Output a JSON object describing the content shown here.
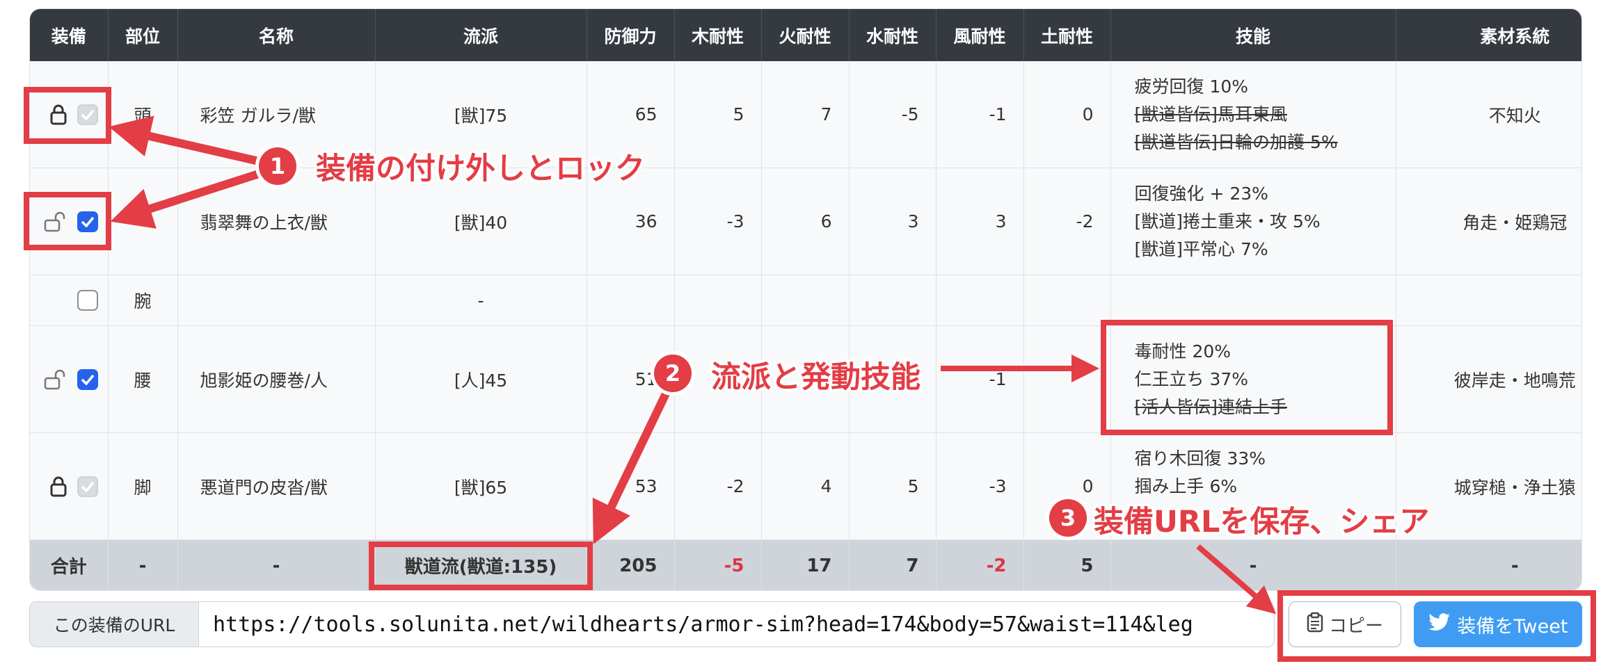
{
  "table": {
    "headers": [
      "装備",
      "部位",
      "名称",
      "流派",
      "防御力",
      "木耐性",
      "火耐性",
      "水耐性",
      "風耐性",
      "土耐性",
      "技能",
      "素材系統"
    ],
    "rows": [
      {
        "lock": "closed",
        "check": "disabled",
        "part": "頭",
        "name": "彩笠 ガルラ/獣",
        "school": "[獣]75",
        "defense": "65",
        "wood": "5",
        "fire": "7",
        "water": "-5",
        "wind": "-1",
        "earth": "0",
        "skills": [
          {
            "text": "疲労回復 10%",
            "struck": false
          },
          {
            "text": "[獣道皆伝]馬耳東風",
            "struck": true
          },
          {
            "text": "[獣道皆伝]日輪の加護 5%",
            "struck": true
          }
        ],
        "material": "不知火"
      },
      {
        "lock": "open",
        "check": "on",
        "part": "",
        "name": "翡翠舞の上衣/獣",
        "school": "[獣]40",
        "defense": "36",
        "wood": "-3",
        "fire": "6",
        "water": "3",
        "wind": "3",
        "earth": "-2",
        "skills": [
          {
            "text": "回復強化 + 23%",
            "struck": false
          },
          {
            "text": "[獣道]捲土重来・攻 5%",
            "struck": false
          },
          {
            "text": "[獣道]平常心 7%",
            "struck": false
          }
        ],
        "material": "角走・姫鶏冠"
      },
      {
        "lock": "none",
        "check": "off",
        "part": "腕",
        "name": "",
        "school": "-",
        "defense": "",
        "wood": "",
        "fire": "",
        "water": "",
        "wind": "",
        "earth": "",
        "skills": [],
        "material": ""
      },
      {
        "lock": "open",
        "check": "on",
        "part": "腰",
        "name": "旭影姫の腰巻/人",
        "school": "[人]45",
        "defense": "51",
        "wood": "",
        "fire": "",
        "water": "",
        "wind": "-1",
        "earth": "",
        "skills": [
          {
            "text": "毒耐性 20%",
            "struck": false
          },
          {
            "text": "仁王立ち 37%",
            "struck": false
          },
          {
            "text": "[活人皆伝]連結上手",
            "struck": true
          }
        ],
        "material": "彼岸走・地鳴荒"
      },
      {
        "lock": "closed",
        "check": "disabled",
        "part": "脚",
        "name": "悪道門の皮沓/獣",
        "school": "[獣]65",
        "defense": "53",
        "wood": "-2",
        "fire": "4",
        "water": "5",
        "wind": "-3",
        "earth": "0",
        "skills": [
          {
            "text": "宿り木回復 33%",
            "struck": false
          },
          {
            "text": "掴み上手 6%",
            "struck": false
          },
          {
            "text": "",
            "struck": false
          }
        ],
        "material": "城穿槌・浄土猿"
      }
    ],
    "totals": {
      "label": "合計",
      "part": "-",
      "name": "-",
      "school": "獣道流(獣道:135)",
      "defense": "205",
      "wood": "-5",
      "fire": "17",
      "water": "7",
      "wind": "-2",
      "earth": "5",
      "skills": "-",
      "material": "-"
    }
  },
  "url_bar": {
    "label": "この装備のURL",
    "value": "https://tools.solunita.net/wildhearts/armor-sim?head=174&body=57&waist=114&leg"
  },
  "buttons": {
    "copy": "コピー",
    "tweet": "装備をTweet"
  },
  "annotations": [
    {
      "number": "1",
      "text": "装備の付け外しとロック"
    },
    {
      "number": "2",
      "text": "流派と発動技能"
    },
    {
      "number": "3",
      "text": "装備URLを保存、シェア"
    }
  ],
  "colors": {
    "annotation": "#e33d45",
    "header": "#343a40",
    "checkbox_on": "#2563eb",
    "tweet": "#3f9cf2",
    "negative": "#dc3545"
  },
  "icons": {
    "lock_closed": "lock-icon",
    "lock_open": "unlock-icon",
    "copy": "clipboard-icon",
    "tweet": "twitter-icon"
  }
}
